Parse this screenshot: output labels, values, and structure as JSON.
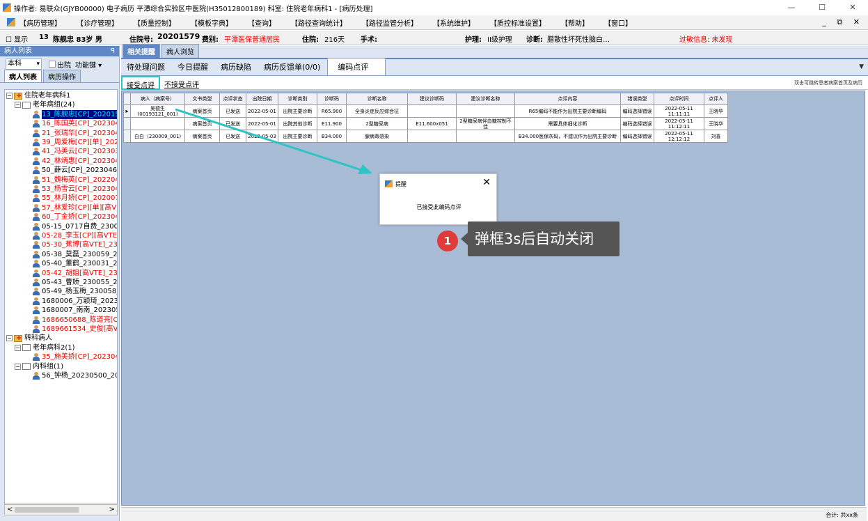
{
  "window": {
    "title": "操作者: 易联众(GJYB00000) 电子病历  平潭综合实验区中医院(H35012800189)  科室: 住院老年病科1 - [病历处理]",
    "controls": [
      "—",
      "☐",
      "✕"
    ]
  },
  "menu": {
    "items": [
      "【病历管理】",
      "【诊疗管理】",
      "【质量控制】",
      "【模板字典】",
      "【查询】",
      "【路径查询统计】",
      "【路径监管分析】",
      "【系统维护】",
      "【质控标准设置】",
      "【帮助】",
      "【窗口】"
    ],
    "mdi_controls": "_ ⧉ ✕"
  },
  "infobar": {
    "show_label": "显示",
    "bed": "13",
    "patient": "陈舰忠 83岁 男",
    "admission_no_label": "住院号:",
    "admission_no": "20201579",
    "fee_type_label": "费别:",
    "fee_type": "平潭医保普通居民",
    "stay_label": "住院:",
    "stay": "216天",
    "surgery_label": "手术:",
    "nursing_label": "护理:",
    "nursing": "II级护理",
    "diagnosis_label": "诊断:",
    "diagnosis": "腊散性坏死性脑白…",
    "allergy": "过敏信息: 未发现"
  },
  "left_panel": {
    "header": "病人列表",
    "pin": "ꟼ",
    "dept": "本科",
    "discharged_label": "出院",
    "func_label": "功能键 ▾",
    "tabs": [
      "病人列表",
      "病历操作"
    ],
    "tree": [
      {
        "text": "住院老年病科1",
        "level": 0,
        "kind": "dept",
        "expander": "⊟",
        "red": false
      },
      {
        "text": "老年病组(24)",
        "level": 1,
        "kind": "group",
        "expander": "⊟",
        "red": false
      },
      {
        "text": "13_陈舰忠[CP]_2020157",
        "level": 2,
        "kind": "patient",
        "selected": true,
        "red": false
      },
      {
        "text": "16_陈国英[CP]_2023041",
        "level": 2,
        "kind": "patient",
        "red": true
      },
      {
        "text": "21_张瑞华[CP]_2023049",
        "level": 2,
        "kind": "patient",
        "red": true
      },
      {
        "text": "39_周爱梅[CP][单]_202",
        "level": 2,
        "kind": "patient",
        "red": true
      },
      {
        "text": "41_冯美云[CP]_2023035",
        "level": 2,
        "kind": "patient",
        "red": true
      },
      {
        "text": "42_林炳惠[CP]_2023049",
        "level": 2,
        "kind": "patient",
        "red": true
      },
      {
        "text": "50_薛云[CP]_20230467_",
        "level": 2,
        "kind": "patient",
        "red": false
      },
      {
        "text": "51_魏梅英[CP]_2022046",
        "level": 2,
        "kind": "patient",
        "red": true
      },
      {
        "text": "53_杨雪云[CP]_2023046",
        "level": 2,
        "kind": "patient",
        "red": true
      },
      {
        "text": "55_林月娇[CP]_2020071",
        "level": 2,
        "kind": "patient",
        "red": true
      },
      {
        "text": "57_林爱珍[CP][单][高V",
        "level": 2,
        "kind": "patient",
        "red": true
      },
      {
        "text": "60_丁金娇[CP]_2023046",
        "level": 2,
        "kind": "patient",
        "red": true
      },
      {
        "text": "05-15_0717自费_230028",
        "level": 2,
        "kind": "patient",
        "red": false
      },
      {
        "text": "05-28_李玉[CP][高VTE]",
        "level": 2,
        "kind": "patient",
        "red": true
      },
      {
        "text": "05-30_蕉博[高VTE]_230",
        "level": 2,
        "kind": "patient",
        "red": true
      },
      {
        "text": "05-38_莫磊_230059_202",
        "level": 2,
        "kind": "patient",
        "red": false
      },
      {
        "text": "05-40_董鹤_230031_202",
        "level": 2,
        "kind": "patient",
        "red": false
      },
      {
        "text": "05-42_胡姐[高VTE]_230",
        "level": 2,
        "kind": "patient",
        "red": true
      },
      {
        "text": "05-43_曹娇_230055_202",
        "level": 2,
        "kind": "patient",
        "red": false
      },
      {
        "text": "05-49_杨玉梅_230058_2",
        "level": 2,
        "kind": "patient",
        "red": false
      },
      {
        "text": "1680006_万颖琦_202305",
        "level": 2,
        "kind": "patient",
        "red": false
      },
      {
        "text": "1680007_南南_20230507",
        "level": 2,
        "kind": "patient",
        "red": false
      },
      {
        "text": "1686650688_陈道亮[CP]",
        "level": 2,
        "kind": "patient",
        "red": true
      },
      {
        "text": "1689661534_史俊[高VTE",
        "level": 2,
        "kind": "patient",
        "red": true
      },
      {
        "text": "转科病人",
        "level": 0,
        "kind": "dept",
        "expander": "⊟",
        "red": false
      },
      {
        "text": "老年病科2(1)",
        "level": 1,
        "kind": "group",
        "expander": "⊟",
        "red": false
      },
      {
        "text": "35_施美娇[CP]_2023048",
        "level": 2,
        "kind": "patient",
        "red": true
      },
      {
        "text": "内科组(1)",
        "level": 1,
        "kind": "group",
        "expander": "⊟",
        "red": false
      },
      {
        "text": "56_钟杨_20230500_2023",
        "level": 2,
        "kind": "patient",
        "red": false
      }
    ]
  },
  "main": {
    "tabs_top": [
      "相关提醒",
      "病人浏览"
    ],
    "tabs_second": [
      "待处理问题",
      "今日提醒",
      "病历缺陷",
      "病历反馈单(0/0)",
      "编码点评"
    ],
    "accept_btn": "接受点评",
    "reject_btn": "不接受点评",
    "hint": "双击可跳转患者病案首页及病历",
    "columns": [
      "病人（病案号）",
      "文书类型",
      "点评状态",
      "出院日期",
      "诊断类别",
      "诊断码",
      "诊断名称",
      "建议诊断码",
      "建议诊断名称",
      "点评内容",
      "错误类型",
      "点评时间",
      "点评人"
    ],
    "rows": [
      [
        "吴德生\n(00193121_001)",
        "病案首页",
        "已发送",
        "2022-05-01",
        "出院主要诊断",
        "R65.900",
        "全身炎症反应综合征",
        "",
        "",
        "R65编码不能作为出院主要诊断编码",
        "编码选择错误",
        "2022-05-11 11:11:11",
        "王晓华"
      ],
      [
        "",
        "病案首页",
        "已发送",
        "2022-05-01",
        "出院其他诊断",
        "E11.900",
        "2型糖尿病",
        "E11.600x051",
        "2型糖尿病伴血糖控制不佳",
        "需要具体细化诊断",
        "编码选择错误",
        "2022-05-11 11:12:11",
        "王晓华"
      ],
      [
        "白白（230009_001)",
        "病案首页",
        "已发送",
        "2022-05-03",
        "出院主要诊断",
        "B34.000",
        "腺病毒感染",
        "",
        "",
        "B34.000医保灰码，不建议作为出院主要诊断",
        "编码选择错误",
        "2022-05-11 12:12:12",
        "刘喜"
      ]
    ],
    "footer": "合计: 共xx条"
  },
  "dialog": {
    "title": "提醒",
    "close": "✕",
    "message": "已接受此编码点评"
  },
  "annotation": {
    "number": "1",
    "text": "弹框3s后自动关闭"
  },
  "colors": {
    "accent": "#2ec4c4",
    "panel_blue": "#5f88c4",
    "grid_bg": "#a9bcd6",
    "badge_red": "#e03a3a"
  }
}
